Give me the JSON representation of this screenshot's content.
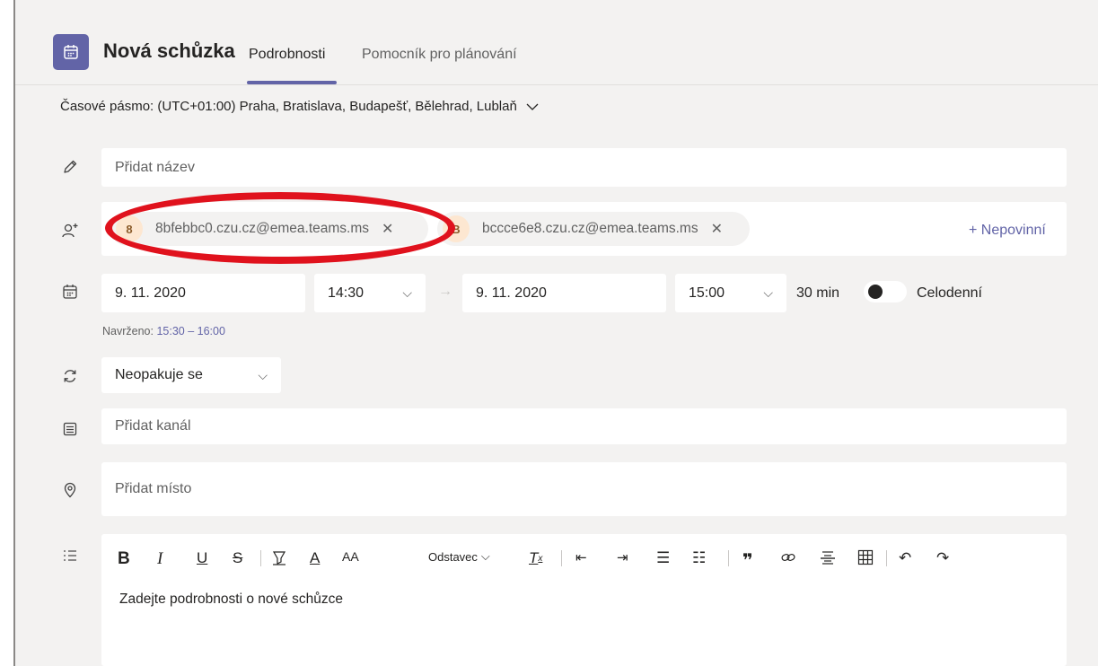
{
  "header": {
    "title": "Nová schůzka",
    "tabs": [
      {
        "label": "Podrobnosti",
        "active": true
      },
      {
        "label": "Pomocník pro plánování",
        "active": false
      }
    ]
  },
  "timezone": {
    "label": "Časové pásmo: (UTC+01:00) Praha, Bratislava, Budapešť, Bělehrad, Lublaň"
  },
  "title_field": {
    "placeholder": "Přidat název"
  },
  "attendees": {
    "chips": [
      {
        "initial": "8",
        "email": "8bfebbc0.czu.cz@emea.teams.ms"
      },
      {
        "initial": "B",
        "email": "bccce6e8.czu.cz@emea.teams.ms"
      }
    ],
    "optional_label": "+ Nepovinní"
  },
  "schedule": {
    "start_date": "9. 11. 2020",
    "start_time": "14:30",
    "end_date": "9. 11. 2020",
    "end_time": "15:00",
    "duration": "30 min",
    "all_day_label": "Celodenní",
    "all_day": false,
    "suggested_label": "Navrženo:",
    "suggested_value": "15:30 – 16:00"
  },
  "repeat": {
    "value": "Neopakuje se"
  },
  "channel": {
    "placeholder": "Přidat kanál"
  },
  "location": {
    "placeholder": "Přidat místo"
  },
  "editor": {
    "paragraph_label": "Odstavec",
    "placeholder": "Zadejte podrobnosti o nové schůzce"
  },
  "colors": {
    "accent": "#6264a7",
    "highlight_ring": "#e0121d",
    "avatar_bg": "#fde7d1"
  }
}
